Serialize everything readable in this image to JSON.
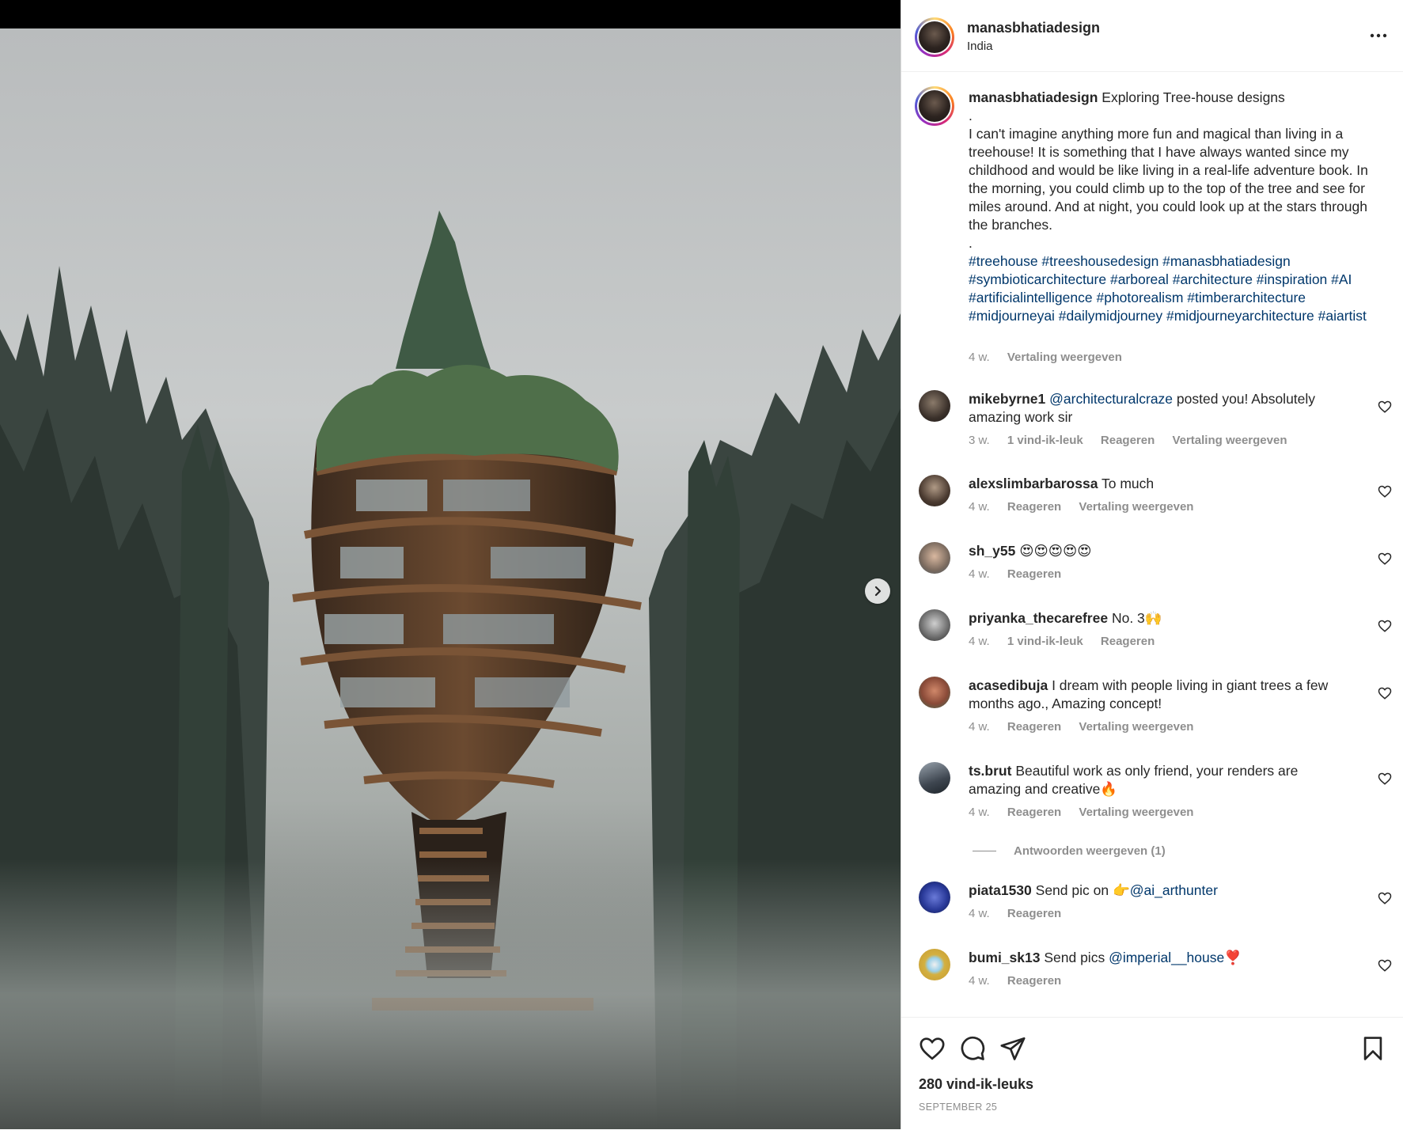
{
  "post": {
    "username": "manasbhatiadesign",
    "location": "India",
    "caption": {
      "username": "manasbhatiadesign",
      "title": "Exploring Tree-house designs",
      "dot1": ".",
      "body": "I can't imagine anything more fun and magical than living in a treehouse! It is something that I have always wanted since my childhood and would be like living in a real-life adventure book. In the morning, you could climb up to the top of the tree and see for miles around. And at night, you could look up at the stars through the branches.",
      "dot2": ".",
      "hashtags": "#treehouse #treeshousedesign #manasbhatiadesign #symbioticarchitecture #arboreal #architecture #inspiration #AI #artificialintelligence #photorealism #timberarchitecture #midjourneyai #dailymidjourney #midjourneyarchitecture #aiartist",
      "time": "4 w.",
      "translate": "Vertaling weergeven"
    },
    "likes": "280 vind-ik-leuks",
    "date": "SEPTEMBER 25"
  },
  "comments": [
    {
      "username": "mikebyrne1",
      "mention": "@architecturalcraze",
      "text": " posted you! Absolutely amazing work sir",
      "time": "3 w.",
      "likes": "1 vind-ik-leuk",
      "reply": "Reageren",
      "translate": "Vertaling weergeven"
    },
    {
      "username": "alexslimbarbarossa",
      "text": "To much",
      "time": "4 w.",
      "reply": "Reageren",
      "translate": "Vertaling weergeven"
    },
    {
      "username": "sh_y55",
      "text": "😍😍😍😍😍",
      "time": "4 w.",
      "reply": "Reageren"
    },
    {
      "username": "priyanka_thecarefree",
      "text": "No. 3🙌",
      "time": "4 w.",
      "likes": "1 vind-ik-leuk",
      "reply": "Reageren"
    },
    {
      "username": "acasedibuja",
      "text": "I dream with people living in giant trees a few months ago., Amazing concept!",
      "time": "4 w.",
      "reply": "Reageren",
      "translate": "Vertaling weergeven"
    },
    {
      "username": "ts.brut",
      "text": "Beautiful work as only friend, your renders are amazing and creative🔥",
      "time": "4 w.",
      "reply": "Reageren",
      "translate": "Vertaling weergeven"
    },
    {
      "username": "piata1530",
      "text": "Send pic on 👉",
      "mention": "@ai_arthunter",
      "time": "4 w.",
      "reply": "Reageren"
    },
    {
      "username": "bumi_sk13",
      "text": "Send pics ",
      "mention": "@imperial__house",
      "suffix": "❣️",
      "time": "4 w.",
      "reply": "Reageren"
    }
  ],
  "view_replies": "Antwoorden weergeven (1)",
  "icons": {
    "next": "chevron-right-icon",
    "more": "more-options-icon",
    "like": "heart-icon",
    "comment": "comment-icon",
    "share": "send-icon",
    "save": "bookmark-icon"
  }
}
